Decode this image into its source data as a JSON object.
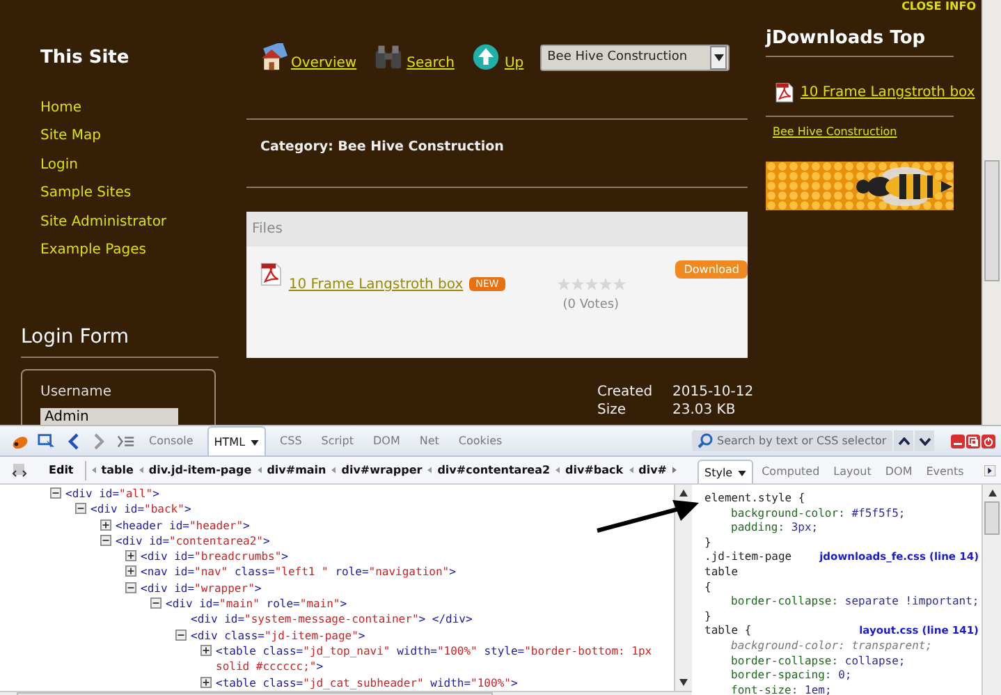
{
  "close_info": "CLOSE INFO",
  "sidebar": {
    "title": "This Site",
    "items": [
      "Home",
      "Site Map",
      "Login",
      "Sample Sites",
      "Site Administrator",
      "Example Pages"
    ]
  },
  "login_form": {
    "title": "Login Form",
    "username_label": "Username",
    "username_value": "Admin"
  },
  "nav": [
    {
      "label": "Overview",
      "kind": "home"
    },
    {
      "label": "Search",
      "kind": "binoculars"
    },
    {
      "label": "Up",
      "kind": "up"
    }
  ],
  "category_select": "Bee Hive Construction",
  "category_heading": "Category: Bee Hive Construction",
  "files_panel": {
    "header": "Files",
    "title": "10 Frame Langstroth box",
    "badge": "NEW",
    "stars": 0,
    "votes": "(0 Votes)",
    "button": "Download"
  },
  "details": [
    {
      "label": "Created",
      "value": "2015-10-12"
    },
    {
      "label": "Size",
      "value": "23.03 KB"
    }
  ],
  "top_downloads": {
    "title": "jDownloads Top",
    "item": "10 Frame Langstroth box",
    "category": "Bee Hive Construction"
  },
  "devtools": {
    "tabs": [
      {
        "label": "Console",
        "selected": false
      },
      {
        "label": "HTML",
        "selected": true
      },
      {
        "label": "CSS",
        "selected": false
      },
      {
        "label": "Script",
        "selected": false
      },
      {
        "label": "DOM",
        "selected": false
      },
      {
        "label": "Net",
        "selected": false
      },
      {
        "label": "Cookies",
        "selected": false
      }
    ],
    "search_placeholder": "Search by text or CSS selector",
    "edit": "Edit",
    "breadcrumbs": [
      "table",
      "div.jd-item-page",
      "div#main",
      "div#wrapper",
      "div#contentarea2",
      "div#back",
      "div#"
    ],
    "side_tabs": [
      {
        "label": "Style",
        "selected": true
      },
      {
        "label": "Computed",
        "selected": false
      },
      {
        "label": "Layout",
        "selected": false
      },
      {
        "label": "DOM",
        "selected": false
      },
      {
        "label": "Events",
        "selected": false
      }
    ],
    "html_tree": [
      {
        "text": "<div id=\"all\">",
        "expanded": true,
        "children": [
          {
            "text": "<div id=\"back\">",
            "expanded": true,
            "children": [
              {
                "text": "<header id=\"header\">",
                "expanded": false
              },
              {
                "text": "<div id=\"contentarea2\">",
                "expanded": true,
                "children": [
                  {
                    "text": "<div id=\"breadcrumbs\">",
                    "expanded": false
                  },
                  {
                    "text": "<nav id=\"nav\" class=\"left1 \" role=\"navigation\">",
                    "expanded": false
                  },
                  {
                    "text": "<div id=\"wrapper\">",
                    "expanded": true,
                    "children": [
                      {
                        "text": "<div id=\"main\" role=\"main\">",
                        "expanded": true,
                        "children": [
                          {
                            "text": "<div id=\"system-message-container\">  </div>"
                          },
                          {
                            "text": "<div class=\"jd-item-page\">",
                            "expanded": true,
                            "children": [
                              {
                                "text": "<table class=\"jd_top_navi\" width=\"100%\" style=\"border-bottom: 1px solid #cccccc;\">",
                                "expanded": false
                              },
                              {
                                "text": "<table class=\"jd_cat_subheader\" width=\"100%\">",
                                "expanded": false
                              }
                            ]
                          }
                        ]
                      }
                    ]
                  }
                ]
              }
            ]
          }
        ]
      }
    ],
    "style_rules": [
      {
        "selector": "element.style {",
        "declarations": [
          {
            "property": "background-color:",
            "value": "#f5f5f5;",
            "overridden": false
          },
          {
            "property": "padding:",
            "value": "3px;",
            "overridden": false
          }
        ],
        "close": "}"
      },
      {
        "selector": ".jd-item-page table",
        "source": "jdownloads_fe.css (line 14)",
        "open": "{",
        "declarations": [
          {
            "property": "border-collapse:",
            "value": "separate !important;",
            "overridden": false
          }
        ],
        "close": "}"
      },
      {
        "selector": "table {",
        "source": "layout.css (line 141)",
        "declarations": [
          {
            "property": "background-color:",
            "value": "transparent;",
            "overridden": true
          },
          {
            "property": "border-collapse:",
            "value": "collapse;",
            "overridden": false
          },
          {
            "property": "border-spacing:",
            "value": "0;",
            "overridden": false
          },
          {
            "property": "font-size:",
            "value": "1em;",
            "overridden": false
          }
        ]
      }
    ]
  }
}
